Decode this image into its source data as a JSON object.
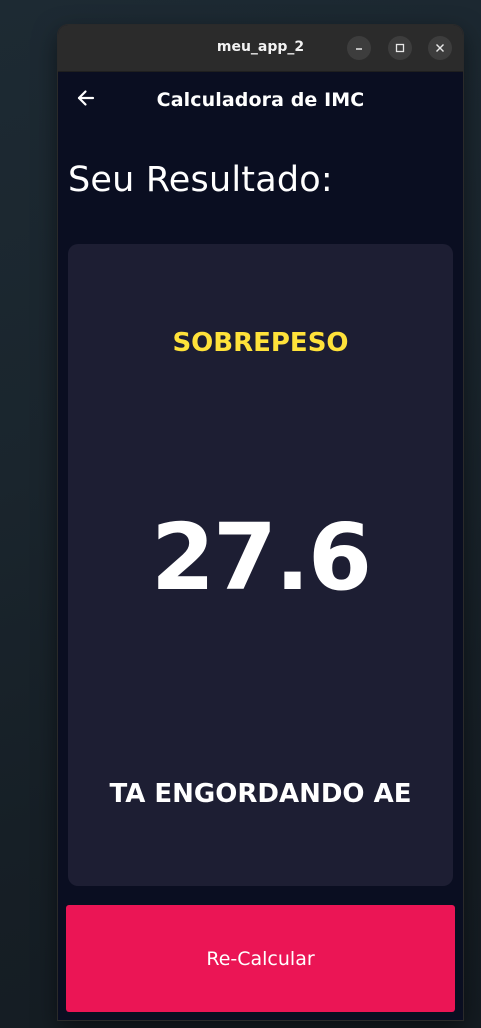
{
  "window": {
    "title": "meu_app_2",
    "controls": {
      "minimize_icon": "minimize-icon",
      "maximize_icon": "maximize-icon",
      "close_icon": "close-icon"
    }
  },
  "appbar": {
    "back_icon": "arrow-back-icon",
    "title": "Calculadora de IMC"
  },
  "main": {
    "heading": "Seu Resultado:",
    "result": {
      "category": "SOBREPESO",
      "value": "27.6",
      "message": "TA ENGORDANDO AE"
    },
    "button_label": "Re-Calcular"
  },
  "colors": {
    "background": "#0a0e21",
    "card": "#1d1e33",
    "category_text": "#ffe23a",
    "button": "#eb1555",
    "titlebar": "#2b2b2b"
  }
}
